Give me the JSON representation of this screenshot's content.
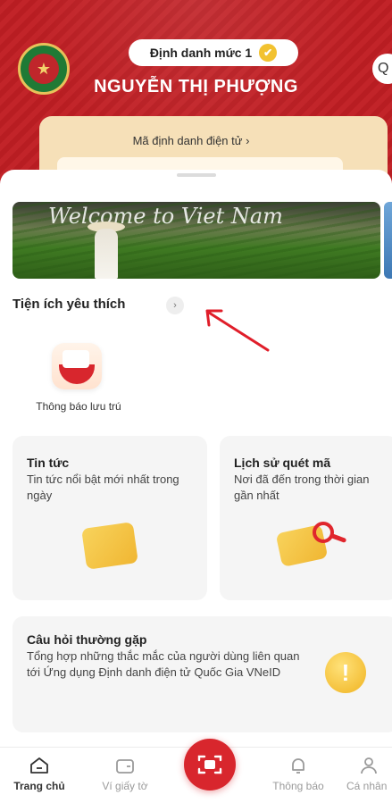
{
  "header": {
    "level_badge": "Định danh mức 1",
    "user_name": "NGUYỄN THỊ PHƯỢNG",
    "id_card_label": "Mã định danh điện tử",
    "id_card_chevron": "›"
  },
  "banner": {
    "text": "Welcome to Viet Nam"
  },
  "favorites": {
    "title": "Tiện ích yêu thích",
    "chevron": "›",
    "items": [
      {
        "label": "Thông báo lưu trú",
        "icon": "residence-notice-icon"
      }
    ]
  },
  "cards": {
    "news": {
      "title": "Tin tức",
      "desc": "Tin tức nổi bật mới nhất trong ngày",
      "icon": "news-icon"
    },
    "scan_history": {
      "title": "Lịch sử quét mã",
      "desc": "Nơi đã đến trong thời gian gần nhất",
      "icon": "scan-history-icon"
    },
    "faq": {
      "title": "Câu hỏi thường gặp",
      "desc": "Tổng hợp những thắc mắc của người dùng liên quan tới Ứng dụng Định danh điện tử Quốc Gia VNeID",
      "icon_glyph": "!"
    }
  },
  "bottom_nav": {
    "home": "Trang chủ",
    "wallet": "Ví giấy tờ",
    "notifications": "Thông báo",
    "profile": "Cá nhân"
  },
  "colors": {
    "brand_red": "#c22429",
    "accent_gold": "#f2c230",
    "card_bg": "#f5f5f5"
  }
}
